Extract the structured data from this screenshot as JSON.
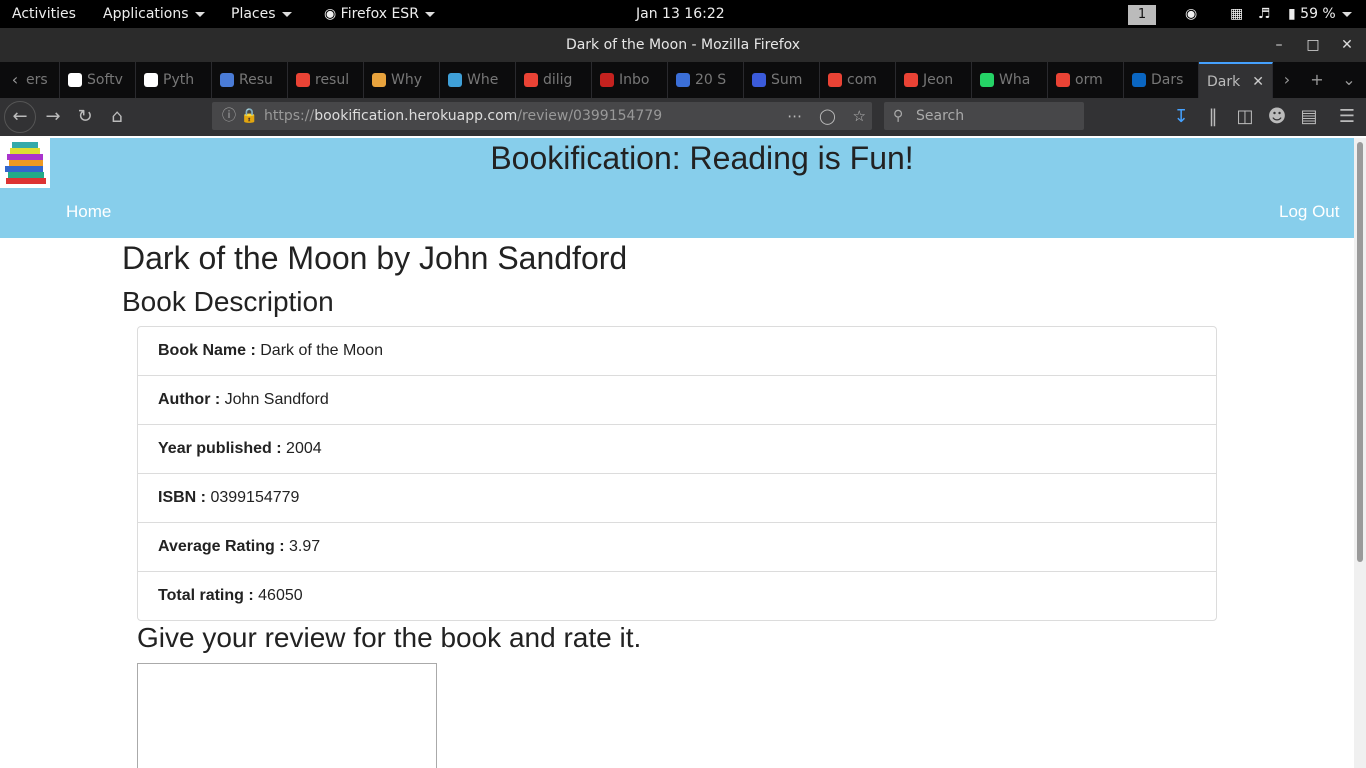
{
  "system": {
    "activities": "Activities",
    "applications": "Applications",
    "places": "Places",
    "app_name": "Firefox ESR",
    "clock": "Jan 13  16:22",
    "workspace": "1",
    "battery": "59 %"
  },
  "window": {
    "title": "Dark of the Moon - Mozilla Firefox"
  },
  "tabs": [
    {
      "label": "ers",
      "color": "#ffffff"
    },
    {
      "label": "Softv",
      "color": "#ffffff"
    },
    {
      "label": "Pyth",
      "color": "#ffffff"
    },
    {
      "label": "Resu",
      "color": "#4a7bd6"
    },
    {
      "label": "resul",
      "color": "#ea4335"
    },
    {
      "label": "Why",
      "color": "#e8a33d"
    },
    {
      "label": "Whe",
      "color": "#3fa0d8"
    },
    {
      "label": "dilig",
      "color": "#ea4335"
    },
    {
      "label": "Inbo",
      "color": "#c5221f"
    },
    {
      "label": "20 S",
      "color": "#3b6fd8"
    },
    {
      "label": "Sum",
      "color": "#3b5bdb"
    },
    {
      "label": "com",
      "color": "#ea4335"
    },
    {
      "label": "Jeon",
      "color": "#ea4335"
    },
    {
      "label": "Wha",
      "color": "#25d366"
    },
    {
      "label": "orm",
      "color": "#ea4335"
    },
    {
      "label": "Dars",
      "color": "#0a66c2"
    },
    {
      "label": "Dark",
      "color": "#323234"
    }
  ],
  "toolbar": {
    "url_prefix": "https://",
    "url_host": "bookification.herokuapp.com",
    "url_path": "/review/0399154779",
    "search_placeholder": "Search"
  },
  "site": {
    "title": "Bookification: Reading is Fun!",
    "nav_home": "Home",
    "nav_logout": "Log Out"
  },
  "book": {
    "heading": "Dark of the Moon by John Sandford",
    "description_heading": "Book Description",
    "details": [
      {
        "label": "Book Name :",
        "value": "Dark of the Moon"
      },
      {
        "label": "Author :",
        "value": "John Sandford"
      },
      {
        "label": "Year published :",
        "value": "2004"
      },
      {
        "label": "ISBN :",
        "value": "0399154779"
      },
      {
        "label": "Average Rating :",
        "value": "3.97"
      },
      {
        "label": "Total rating :",
        "value": "46050"
      }
    ]
  },
  "review": {
    "heading": "Give your review for the book and rate it.",
    "text": ""
  },
  "colors": {
    "header_bg": "#87ceeb",
    "accent": "#45a1ff"
  }
}
